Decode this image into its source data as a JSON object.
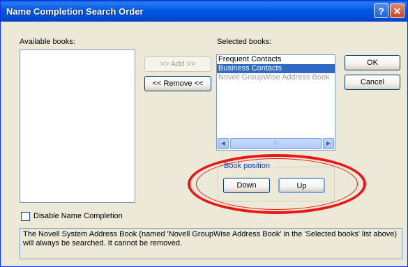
{
  "window": {
    "title": "Name Completion Search Order",
    "help_glyph": "?",
    "close_glyph": "✕"
  },
  "available": {
    "label": "Available books:",
    "items": []
  },
  "selected": {
    "label": "Selected books:",
    "items": [
      "Frequent Contacts",
      "Business Contacts",
      "Novell GroupWise Address Book"
    ]
  },
  "buttons": {
    "add": ">> Add >>",
    "remove": "<< Remove <<",
    "ok": "OK",
    "cancel": "Cancel",
    "down": "Down",
    "up": "Up"
  },
  "scrollbar": {
    "left_glyph": "◀",
    "right_glyph": "▶",
    "thumb_glyph": "|||"
  },
  "book_position": {
    "label": "Book position"
  },
  "disable": {
    "label": "Disable Name Completion",
    "checked": false
  },
  "info_text": "The Novell System Address Book (named 'Novell GroupWise Address Book' in the 'Selected books' list above) will always be searched.  It cannot be removed.",
  "colors": {
    "titlebar": "#0058e6",
    "selection": "#316ac5",
    "annotation": "#e81818"
  }
}
